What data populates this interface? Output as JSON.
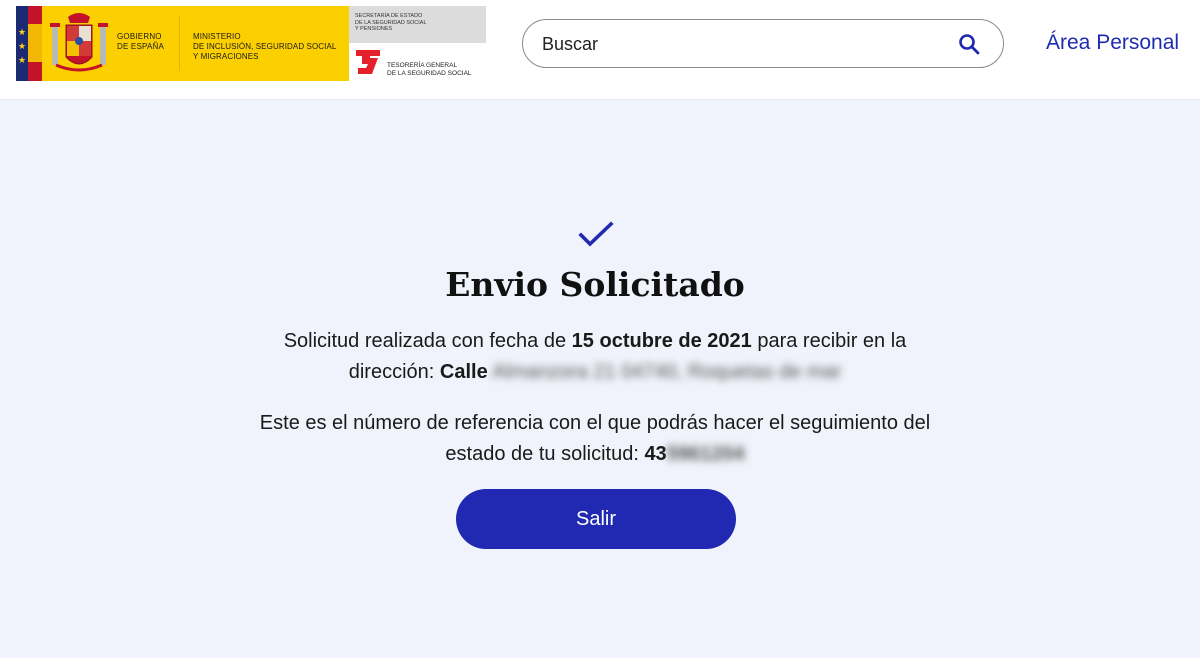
{
  "header": {
    "logo": {
      "gov_line1": "GOBIERNO",
      "gov_line2": "DE ESPAÑA",
      "ministry_line1": "MINISTERIO",
      "ministry_line2": "DE INCLUSIÓN, SEGURIDAD SOCIAL",
      "ministry_line3": "Y MIGRACIONES",
      "secretaria_line1": "SECRETARÍA DE ESTADO",
      "secretaria_line2": "DE LA SEGURIDAD SOCIAL",
      "secretaria_line3": "Y PENSIONES",
      "tgss_line1": "TESORERÍA GENERAL",
      "tgss_line2": "DE LA SEGURIDAD SOCIAL"
    },
    "search": {
      "placeholder": "Buscar",
      "icon": "search-icon"
    },
    "area_personal_label": "Área Personal"
  },
  "confirmation": {
    "icon": "checkmark-icon",
    "title": "Envio Solicitado",
    "request_prefix": "Solicitud realizada con fecha de ",
    "request_date": "15 octubre de 2021",
    "request_middle": " para recibir en la dirección: ",
    "address_street": "Calle",
    "address_blurred": "Almanzora 21 04740, Roquetas de mar",
    "reference_prefix": "Este es el número de referencia con el que podrás hacer el seguimiento del estado de tu solicitud: ",
    "reference_visible": "43",
    "reference_blurred": "5961204",
    "exit_button_label": "Salir"
  },
  "colors": {
    "brand_blue": "#2128b1",
    "link_blue": "#1f2bb1",
    "page_background": "#f0f3fb",
    "logo_yellow": "#fccf00"
  }
}
